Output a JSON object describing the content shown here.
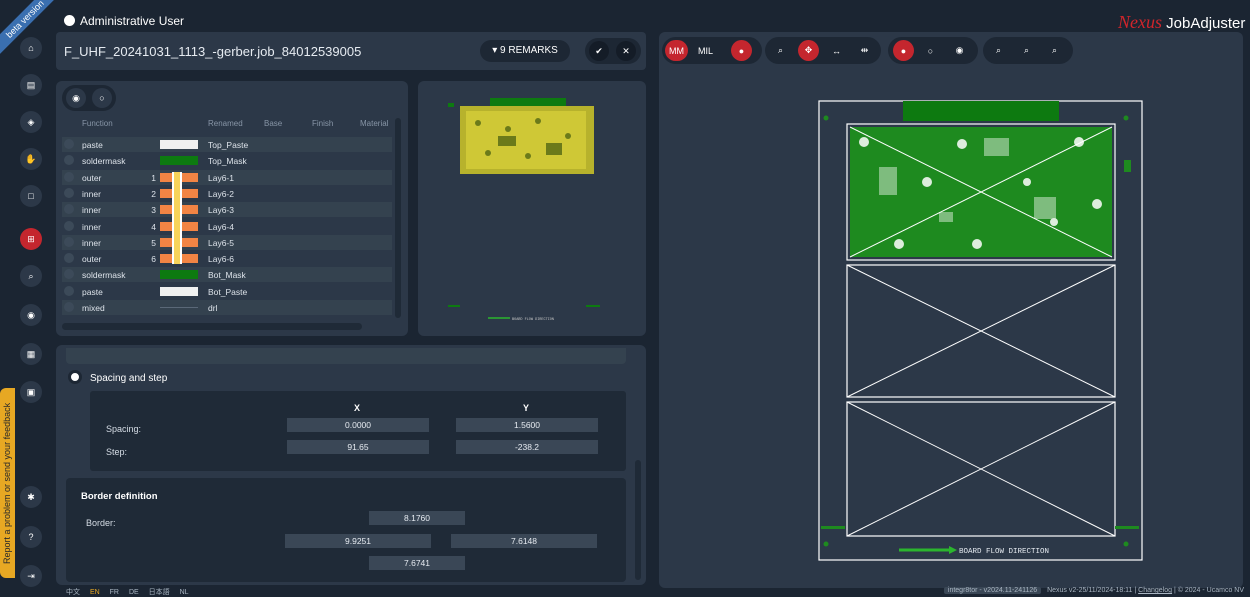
{
  "header": {
    "user_label": "Administrative User",
    "job_title": "F_UHF_20241031_1113_-gerber.job_84012539005",
    "remarks_label": "▾ 9 REMARKS",
    "beta_ribbon": "beta version",
    "logo_brand": "Nexus",
    "logo_product": "JobAdjuster"
  },
  "sidebar": {
    "feedback_label": "Report a problem or send your feedback",
    "items": [
      {
        "icon": "home-icon",
        "glyph": "⌂"
      },
      {
        "icon": "document-icon",
        "glyph": "▤"
      },
      {
        "icon": "layers-icon",
        "glyph": "◈"
      },
      {
        "icon": "hand-icon",
        "glyph": "✋"
      },
      {
        "icon": "square-icon",
        "glyph": "□"
      },
      {
        "icon": "grid-icon",
        "glyph": "⊞"
      },
      {
        "icon": "zoom-icon",
        "glyph": "⌕"
      },
      {
        "icon": "database-icon",
        "glyph": "◉"
      },
      {
        "icon": "panel-icon",
        "glyph": "▦"
      },
      {
        "icon": "table-icon",
        "glyph": "▣"
      },
      {
        "icon": "settings-icon",
        "glyph": "✱"
      },
      {
        "icon": "help-icon",
        "glyph": "?"
      },
      {
        "icon": "logout-icon",
        "glyph": "⇥"
      }
    ]
  },
  "layer_table": {
    "headers": [
      "Function",
      "Renamed",
      "Base",
      "Finish",
      "Material"
    ],
    "rows": [
      {
        "function": "paste",
        "num": "",
        "color": "#f0f0f0",
        "renamed": "Top_Paste"
      },
      {
        "function": "soldermask",
        "num": "",
        "color": "#0d7a10",
        "renamed": "Top_Mask"
      },
      {
        "function": "outer",
        "num": "1",
        "color": "#f28444",
        "renamed": "Lay6-1"
      },
      {
        "function": "inner",
        "num": "2",
        "color": "#f28444",
        "renamed": "Lay6-2"
      },
      {
        "function": "inner",
        "num": "3",
        "color": "#f28444",
        "renamed": "Lay6-3"
      },
      {
        "function": "inner",
        "num": "4",
        "color": "#f28444",
        "renamed": "Lay6-4"
      },
      {
        "function": "inner",
        "num": "5",
        "color": "#f28444",
        "renamed": "Lay6-5"
      },
      {
        "function": "outer",
        "num": "6",
        "color": "#f28444",
        "renamed": "Lay6-6"
      },
      {
        "function": "soldermask",
        "num": "",
        "color": "#0d7a10",
        "renamed": "Bot_Mask"
      },
      {
        "function": "paste",
        "num": "",
        "color": "#f0f0f0",
        "renamed": "Bot_Paste"
      },
      {
        "function": "mixed",
        "num": "",
        "color": "",
        "renamed": "drl"
      }
    ]
  },
  "spacing": {
    "section_label": "Spacing and step",
    "col_x": "X",
    "col_y": "Y",
    "spacing_label": "Spacing:",
    "spacing_x": "0.0000",
    "spacing_y": "1.5600",
    "step_label": "Step:",
    "step_x": "91.65",
    "step_y": "-238.2"
  },
  "border": {
    "section_label": "Border definition",
    "border_label": "Border:",
    "top": "8.1760",
    "left": "9.9251",
    "right": "7.6148",
    "bottom": "7.6741"
  },
  "viewer": {
    "unit_mm": "MM",
    "unit_mil": "MIL",
    "flow_label": "BOARD FLOW DIRECTION",
    "preview_flow_label": "BOARD FLOW DIRECTION"
  },
  "footer": {
    "languages": [
      "中文",
      "EN",
      "FR",
      "DE",
      "日本語",
      "NL"
    ],
    "active_language": "EN",
    "integr_pill": "integr8tor - v2024.11-241126",
    "version": "Nexus v2-25/11/2024-18:11 |",
    "changelog": "Changelog",
    "copyright": "| © 2024 - Ucamco NV"
  },
  "colors": {
    "accent_red": "#c4262e",
    "panel_bg": "#2c3848",
    "page_bg": "#1b2532",
    "pcb_green": "#0d7a10",
    "copper_yellow": "#d9d23a"
  }
}
